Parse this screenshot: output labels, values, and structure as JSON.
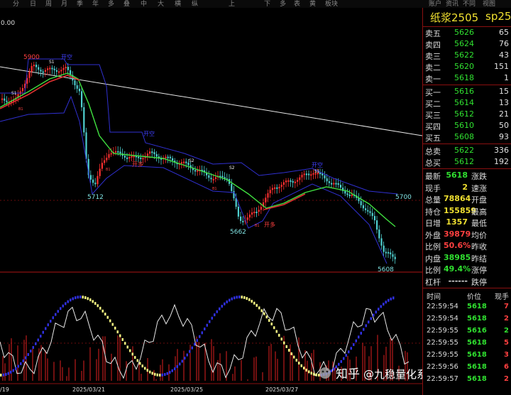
{
  "toolbar": [
    "分",
    "日",
    "周",
    "月",
    "季",
    "年",
    "多",
    "叠",
    "中",
    "大",
    "横",
    "纵",
    "上",
    "下",
    "多",
    "表",
    "黄",
    "板块",
    "账户",
    "资讯",
    "不同",
    "视图"
  ],
  "chart": {
    "top_value": "0.00",
    "dates": [
      "/19",
      "2025/03/21",
      "2025/03/25",
      "2025/03/27"
    ],
    "price_labels": [
      {
        "text": "5900",
        "c": "#ff4040"
      },
      {
        "text": "5712",
        "c": "#7fe0e0"
      },
      {
        "text": "5662",
        "c": "#7fe0e0"
      },
      {
        "text": "5700",
        "c": "#7fe0e0"
      },
      {
        "text": "5608",
        "c": "#7fe0e0"
      }
    ],
    "signals": [
      {
        "text": "开空",
        "c": "#4040ff"
      },
      {
        "text": "开空",
        "c": "#4040ff"
      },
      {
        "text": "开多",
        "c": "#ff4040"
      },
      {
        "text": "开多",
        "c": "#ff4040"
      },
      {
        "text": "开空",
        "c": "#4040ff"
      },
      {
        "text": "S1",
        "c": "#eeeeee"
      },
      {
        "text": "S1",
        "c": "#eeeeee"
      },
      {
        "text": "S2",
        "c": "#eeeeee"
      },
      {
        "text": "S2",
        "c": "#eeeeee"
      },
      {
        "text": "S1",
        "c": "#eeeeee"
      },
      {
        "text": "B1",
        "c": "#ff4040"
      },
      {
        "text": "B1",
        "c": "#ff4040"
      },
      {
        "text": "B1",
        "c": "#ff4040"
      },
      {
        "text": "B1",
        "c": "#ff4040"
      }
    ],
    "watermark": {
      "brand": "知乎",
      "handle": "@九稳量化系统网"
    }
  },
  "quote": {
    "symbol": "纸浆2505",
    "symbol2": "sp250",
    "asks": [
      {
        "label": "卖五",
        "price": "5626",
        "vol": "65"
      },
      {
        "label": "卖四",
        "price": "5624",
        "vol": "76"
      },
      {
        "label": "卖三",
        "price": "5622",
        "vol": "43"
      },
      {
        "label": "卖二",
        "price": "5620",
        "vol": "151"
      },
      {
        "label": "卖一",
        "price": "5618",
        "vol": "1"
      }
    ],
    "bids": [
      {
        "label": "买一",
        "price": "5616",
        "vol": "15"
      },
      {
        "label": "买二",
        "price": "5614",
        "vol": "13"
      },
      {
        "label": "买三",
        "price": "5612",
        "vol": "21"
      },
      {
        "label": "买四",
        "price": "5610",
        "vol": "50"
      },
      {
        "label": "买五",
        "price": "5608",
        "vol": "93"
      }
    ],
    "totals": [
      {
        "label": "总卖",
        "price": "5622",
        "vol": "336"
      },
      {
        "label": "总买",
        "price": "5612",
        "vol": "192"
      }
    ],
    "stats": [
      {
        "label": "最新",
        "value": "5618",
        "vc": "#30e030",
        "label2": "涨跌"
      },
      {
        "label": "现手",
        "value": "2",
        "vc": "#f0e030",
        "label2": "速涨"
      },
      {
        "label": "总量",
        "value": "78864",
        "vc": "#f0e030",
        "label2": "开盘"
      },
      {
        "label": "持仓",
        "value": "155859",
        "vc": "#f0e030",
        "label2": "最高"
      },
      {
        "label": "日增",
        "value": "1357",
        "vc": "#f0e030",
        "label2": "最低"
      },
      {
        "label": "外盘",
        "value": "39879",
        "vc": "#ff4040",
        "label2": "均价"
      },
      {
        "label": "比例",
        "value": "50.6%",
        "vc": "#ff4040",
        "label2": "昨收"
      },
      {
        "label": "内盘",
        "value": "38985",
        "vc": "#30e030",
        "label2": "昨结"
      },
      {
        "label": "比例",
        "value": "49.4%",
        "vc": "#30e030",
        "label2": "涨停"
      },
      {
        "label": "杠杆",
        "value": "------",
        "vc": "#dddddd",
        "label2": "跌停"
      }
    ],
    "ticks_header": {
      "time": "时间",
      "price": "价位",
      "qty": "现手"
    },
    "ticks": [
      {
        "time": "22:59:54",
        "price": "5618",
        "pc": "#30e030",
        "qty": "7",
        "qc": "#ff4040"
      },
      {
        "time": "22:59:54",
        "price": "5618",
        "pc": "#30e030",
        "qty": "2",
        "qc": "#ff4040"
      },
      {
        "time": "22:59:55",
        "price": "5616",
        "pc": "#30e030",
        "qty": "2",
        "qc": "#30e030"
      },
      {
        "time": "22:59:55",
        "price": "5618",
        "pc": "#30e030",
        "qty": "5",
        "qc": "#ff4040"
      },
      {
        "time": "22:59:55",
        "price": "5618",
        "pc": "#30e030",
        "qty": "3",
        "qc": "#ff4040"
      },
      {
        "time": "22:59:56",
        "price": "5618",
        "pc": "#30e030",
        "qty": "6",
        "qc": "#ff4040"
      },
      {
        "time": "22:59:57",
        "price": "5618",
        "pc": "#30e030",
        "qty": "2",
        "qc": "#ff4040"
      }
    ],
    "colors": {
      "up": "#ff4040",
      "down": "#30e030",
      "border": "#8a1010",
      "yellow": "#f0e030"
    }
  }
}
